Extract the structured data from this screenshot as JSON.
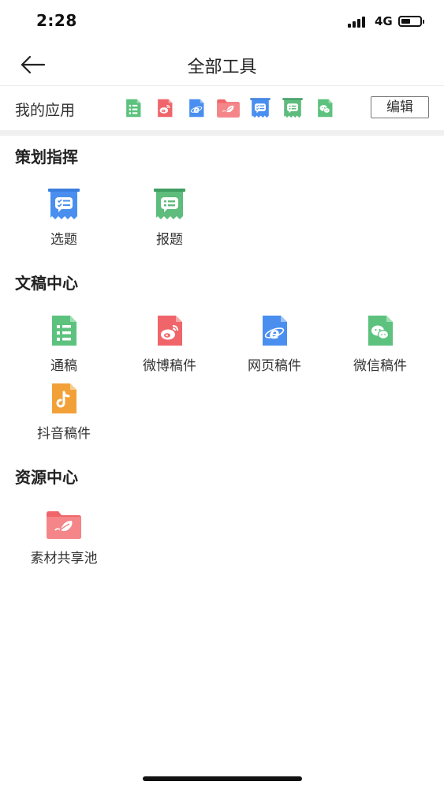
{
  "status_bar": {
    "time": "2:28",
    "network": "4G"
  },
  "header": {
    "title": "全部工具"
  },
  "my_apps": {
    "label": "我的应用",
    "edit_label": "编辑",
    "icons": [
      "list-doc-icon",
      "weibo-doc-icon",
      "web-doc-icon",
      "folder-icon",
      "topic-select-icon",
      "topic-report-icon",
      "wechat-doc-icon"
    ]
  },
  "sections": [
    {
      "title": "策划指挥",
      "items": [
        {
          "label": "选题",
          "icon": "topic-select-icon",
          "color": "#4a8ff0"
        },
        {
          "label": "报题",
          "icon": "topic-report-icon",
          "color": "#5ebc7c"
        }
      ]
    },
    {
      "title": "文稿中心",
      "items": [
        {
          "label": "通稿",
          "icon": "list-doc-icon",
          "color": "#5cc27e"
        },
        {
          "label": "微博稿件",
          "icon": "weibo-doc-icon",
          "color": "#f0656a"
        },
        {
          "label": "网页稿件",
          "icon": "web-doc-icon",
          "color": "#4a8ff0"
        },
        {
          "label": "微信稿件",
          "icon": "wechat-doc-icon",
          "color": "#5cc27e"
        },
        {
          "label": "抖音稿件",
          "icon": "douyin-doc-icon",
          "color": "#f2a138"
        }
      ]
    },
    {
      "title": "资源中心",
      "items": [
        {
          "label": "素材共享池",
          "icon": "folder-icon",
          "color": "#f0656a"
        }
      ]
    }
  ]
}
